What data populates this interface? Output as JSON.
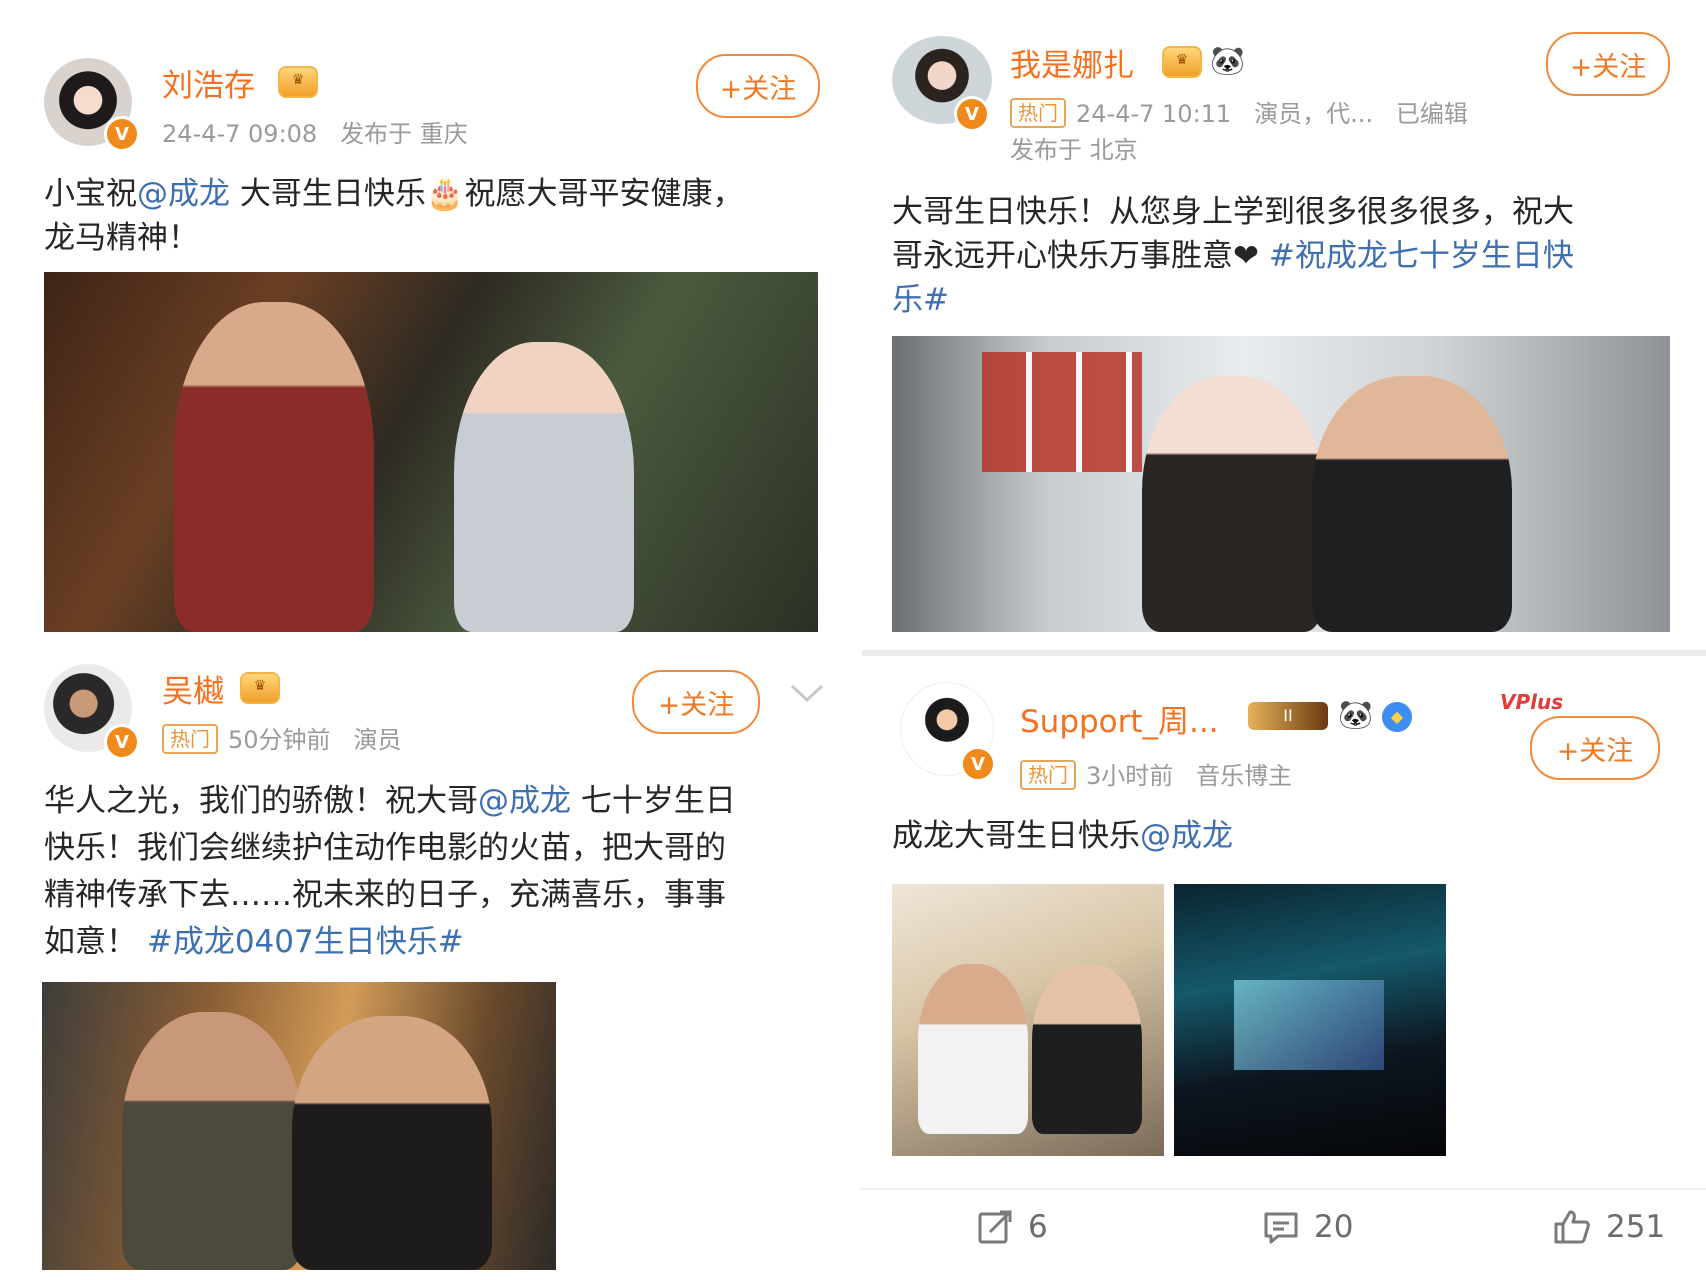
{
  "posts": [
    {
      "name": "刘浩存",
      "time": "24-4-7 09:08",
      "location": "发布于 重庆",
      "follow": "+关注",
      "text_a": "小宝祝",
      "mention": "@成龙",
      "text_b": " 大哥生日快乐🎂祝愿大哥平安健康，",
      "text_c": "龙马精神！"
    },
    {
      "name": "我是娜扎",
      "hot": "热门",
      "time": "24-4-7 10:11",
      "role": "演员，代...",
      "edited": "已编辑",
      "location": "发布于 北京",
      "follow": "+关注",
      "text_a": "大哥生日快乐！从您身上学到很多很多很多，祝大",
      "text_b": "哥永远开心快乐万事胜意❤",
      "tag_a": "#祝成龙七十岁生日快",
      "tag_b": "乐#"
    },
    {
      "name": "吴樾",
      "hot": "热门",
      "time": "50分钟前",
      "role": "演员",
      "follow": "+关注",
      "line1_a": "华人之光，我们的骄傲！祝大哥",
      "line1_mention": "@成龙",
      "line1_b": " 七十岁生日",
      "line2": "快乐！我们会继续护住动作电影的火苗，把大哥的",
      "line3": "精神传承下去……祝未来的日子，充满喜乐，事事",
      "line4_a": "如意！",
      "line4_tag": "#成龙0407生日快乐#"
    },
    {
      "name": "Support_周...",
      "badge_level": "II",
      "hot": "热门",
      "time": "3小时前",
      "role": "音乐博主",
      "follow": "+关注",
      "vplus": "VPlus",
      "text_a": "成龙大哥生日快乐",
      "mention": "@成龙"
    }
  ],
  "actions": {
    "repost_count": "6",
    "comment_count": "20",
    "like_count": "251"
  },
  "icons": [
    "crown-icon",
    "panda-icon",
    "verified-icon",
    "repost-icon",
    "comment-icon",
    "like-icon",
    "chevron-down-icon"
  ],
  "colors": {
    "name": "#f5711f",
    "link": "#3e6fb0",
    "follow": "#f07a24",
    "meta": "#9a9a9a"
  }
}
